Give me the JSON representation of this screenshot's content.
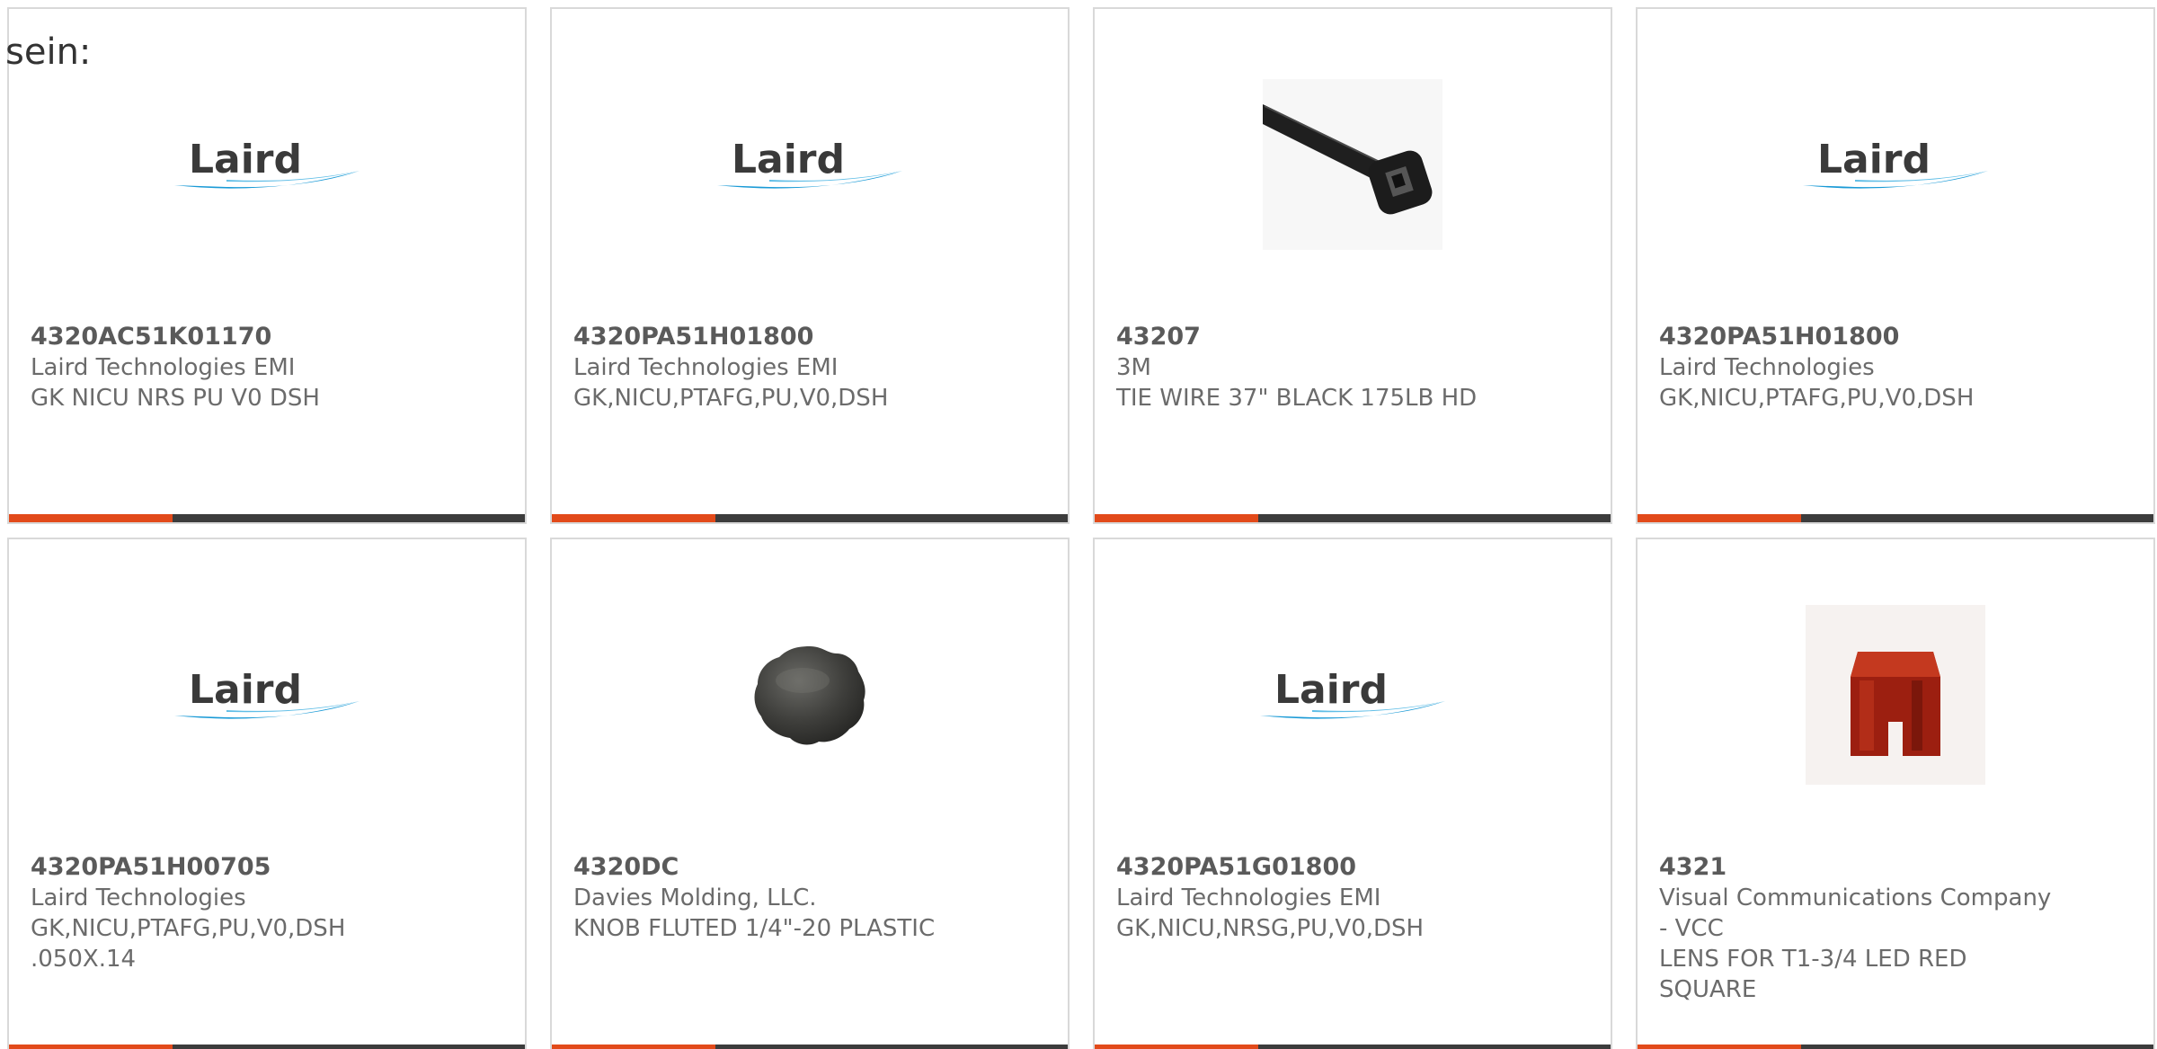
{
  "intro_text": "sein:",
  "colors": {
    "accent": "#e24a1a",
    "bar": "#3c3c3c",
    "border": "#d9d9d9",
    "text": "#6b6b6b",
    "laird_blue": "#1a9ad6"
  },
  "products": [
    {
      "part_number": "4320AC51K01170",
      "manufacturer": "Laird Technologies EMI",
      "description_lines": [
        "GK NICU NRS PU V0 DSH"
      ],
      "image": "laird-logo",
      "logo_text": "Laird"
    },
    {
      "part_number": "4320PA51H01800",
      "manufacturer": "Laird Technologies EMI",
      "description_lines": [
        "GK,NICU,PTAFG,PU,V0,DSH"
      ],
      "image": "laird-logo",
      "logo_text": "Laird"
    },
    {
      "part_number": "43207",
      "manufacturer": "3M",
      "description_lines": [
        "TIE WIRE 37\" BLACK 175LB HD"
      ],
      "image": "cable-tie-image"
    },
    {
      "part_number": "4320PA51H01800",
      "manufacturer": "Laird Technologies",
      "description_lines": [
        "GK,NICU,PTAFG,PU,V0,DSH"
      ],
      "image": "laird-logo",
      "logo_text": "Laird"
    },
    {
      "part_number": "4320PA51H00705",
      "manufacturer": "Laird Technologies",
      "description_lines": [
        "GK,NICU,PTAFG,PU,V0,DSH",
        ".050X.14"
      ],
      "image": "laird-logo",
      "logo_text": "Laird"
    },
    {
      "part_number": "4320DC",
      "manufacturer": "Davies Molding, LLC.",
      "description_lines": [
        "KNOB FLUTED 1/4\"-20 PLASTIC"
      ],
      "image": "knob-image"
    },
    {
      "part_number": "4320PA51G01800",
      "manufacturer": "Laird Technologies EMI",
      "description_lines": [
        "GK,NICU,NRSG,PU,V0,DSH"
      ],
      "image": "laird-logo",
      "logo_text": "Laird"
    },
    {
      "part_number": "4321",
      "manufacturer": "Visual Communications Company - VCC",
      "manufacturer_lines": [
        "Visual Communications Company",
        "- VCC"
      ],
      "description_lines": [
        "LENS FOR T1-3/4 LED RED",
        "SQUARE"
      ],
      "image": "led-lens-image"
    }
  ]
}
